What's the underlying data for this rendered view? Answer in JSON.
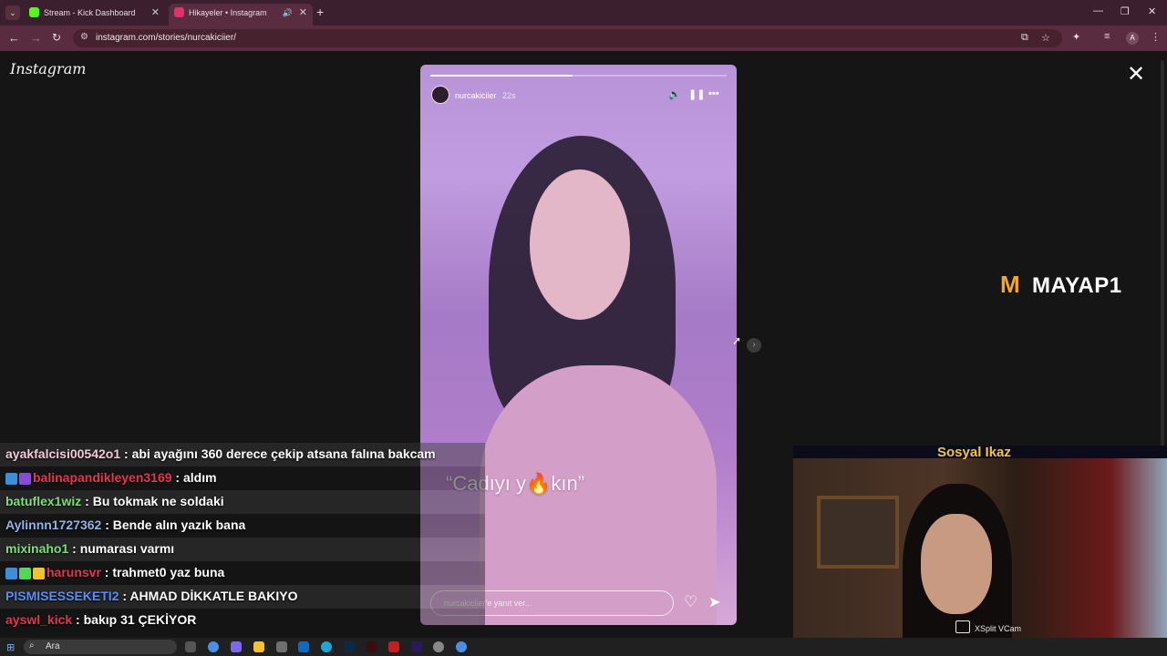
{
  "browser": {
    "tabs": [
      {
        "title": "Stream - Kick Dashboard",
        "color": "#53fc18"
      },
      {
        "title": "Hikayeler • Instagram",
        "color": "#e1306c"
      }
    ],
    "url": "instagram.com/stories/nurcakiciier/"
  },
  "instagram": {
    "logo": "Instagram",
    "story": {
      "username": "nurcakiciier",
      "time": "22s",
      "progress": 0.48,
      "caption": "“Cadıyı y🔥kın”",
      "reply_placeholder": "nurcakiciier'e yanıt ver..."
    }
  },
  "overlay": {
    "brand": "MAYAP1",
    "chat": [
      {
        "user": "ayakfalcisi00542o1",
        "color": "#f2c9d9",
        "msg": "abi ayağını 360 derece çekip atsana falına bakcam",
        "badges": []
      },
      {
        "user": "balinapandikleyen3169",
        "color": "#e2374f",
        "msg": "aldım",
        "badges": [
          "#3a8fd8",
          "#8a4bd8"
        ]
      },
      {
        "user": "batuflex1wiz",
        "color": "#7be07b",
        "msg": "Bu tokmak ne soldaki",
        "badges": []
      },
      {
        "user": "Aylinnn1727362",
        "color": "#8fb3e6",
        "msg": "Bende alın yazık bana",
        "badges": []
      },
      {
        "user": "mixinaho1",
        "color": "#7be07b",
        "msg": "numarası varmı",
        "badges": []
      },
      {
        "user": "harunsvr",
        "color": "#e2374f",
        "msg": "trahmet0 yaz buna",
        "badges": [
          "#3a8fd8",
          "#53d853",
          "#f2c230"
        ]
      },
      {
        "user": "PISMISESSEKETI2",
        "color": "#5b8ef0",
        "msg": "AHMAD DİKKATLE BAKIYO",
        "badges": []
      },
      {
        "user": "ayswl_kick",
        "color": "#e2374f",
        "msg": "bakıp 31 ÇEKİYOR",
        "badges": []
      }
    ],
    "cam_title": "Sosyal Ikaz",
    "cam_label": "XSplit VCam"
  },
  "taskbar": {
    "search_placeholder": "Ara"
  }
}
